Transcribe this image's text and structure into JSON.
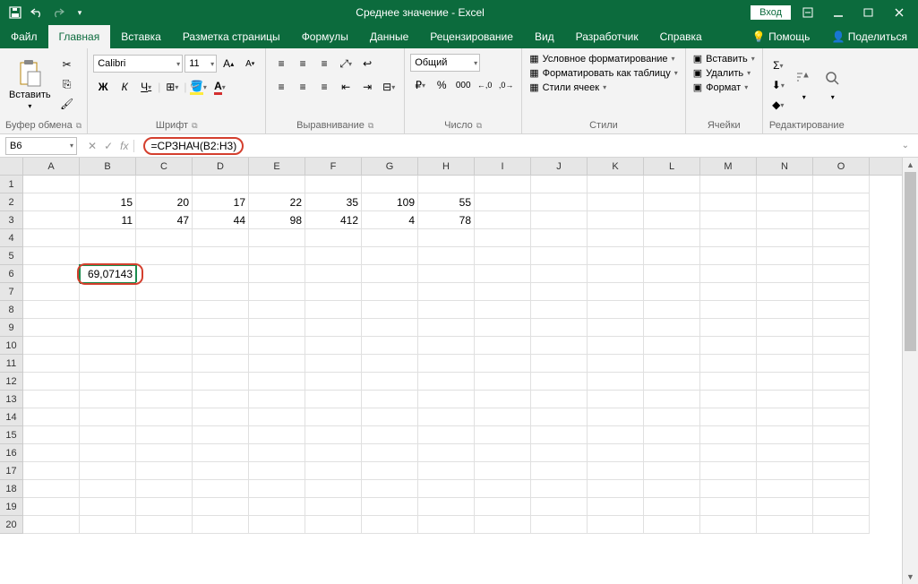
{
  "title": "Среднее значение  -  Excel",
  "login": "Вход",
  "tabs": {
    "file": "Файл",
    "home": "Главная",
    "insert": "Вставка",
    "layout": "Разметка страницы",
    "formulas": "Формулы",
    "data": "Данные",
    "review": "Рецензирование",
    "view": "Вид",
    "developer": "Разработчик",
    "help": "Справка",
    "tell": "Помощь",
    "share": "Поделиться"
  },
  "ribbon": {
    "clipboard": {
      "paste": "Вставить",
      "label": "Буфер обмена"
    },
    "font": {
      "name": "Calibri",
      "size": "11",
      "bold": "Ж",
      "italic": "К",
      "underline": "Ч",
      "label": "Шрифт"
    },
    "align": {
      "label": "Выравнивание"
    },
    "number": {
      "format": "Общий",
      "label": "Число"
    },
    "styles": {
      "cond": "Условное форматирование",
      "table": "Форматировать как таблицу",
      "cell": "Стили ячеек",
      "label": "Стили"
    },
    "cells": {
      "insert": "Вставить",
      "delete": "Удалить",
      "format": "Формат",
      "label": "Ячейки"
    },
    "editing": {
      "label": "Редактирование"
    }
  },
  "namebox": "B6",
  "formula": "=СРЗНАЧ(B2:H3)",
  "columns": [
    "A",
    "B",
    "C",
    "D",
    "E",
    "F",
    "G",
    "H",
    "I",
    "J",
    "K",
    "L",
    "M",
    "N",
    "O"
  ],
  "row_count": 20,
  "cells": {
    "r2": {
      "B": "15",
      "C": "20",
      "D": "17",
      "E": "22",
      "F": "35",
      "G": "109",
      "H": "55"
    },
    "r3": {
      "B": "11",
      "C": "47",
      "D": "44",
      "E": "98",
      "F": "412",
      "G": "4",
      "H": "78"
    },
    "r6": {
      "B": "69,07143"
    }
  },
  "selected": "B6"
}
